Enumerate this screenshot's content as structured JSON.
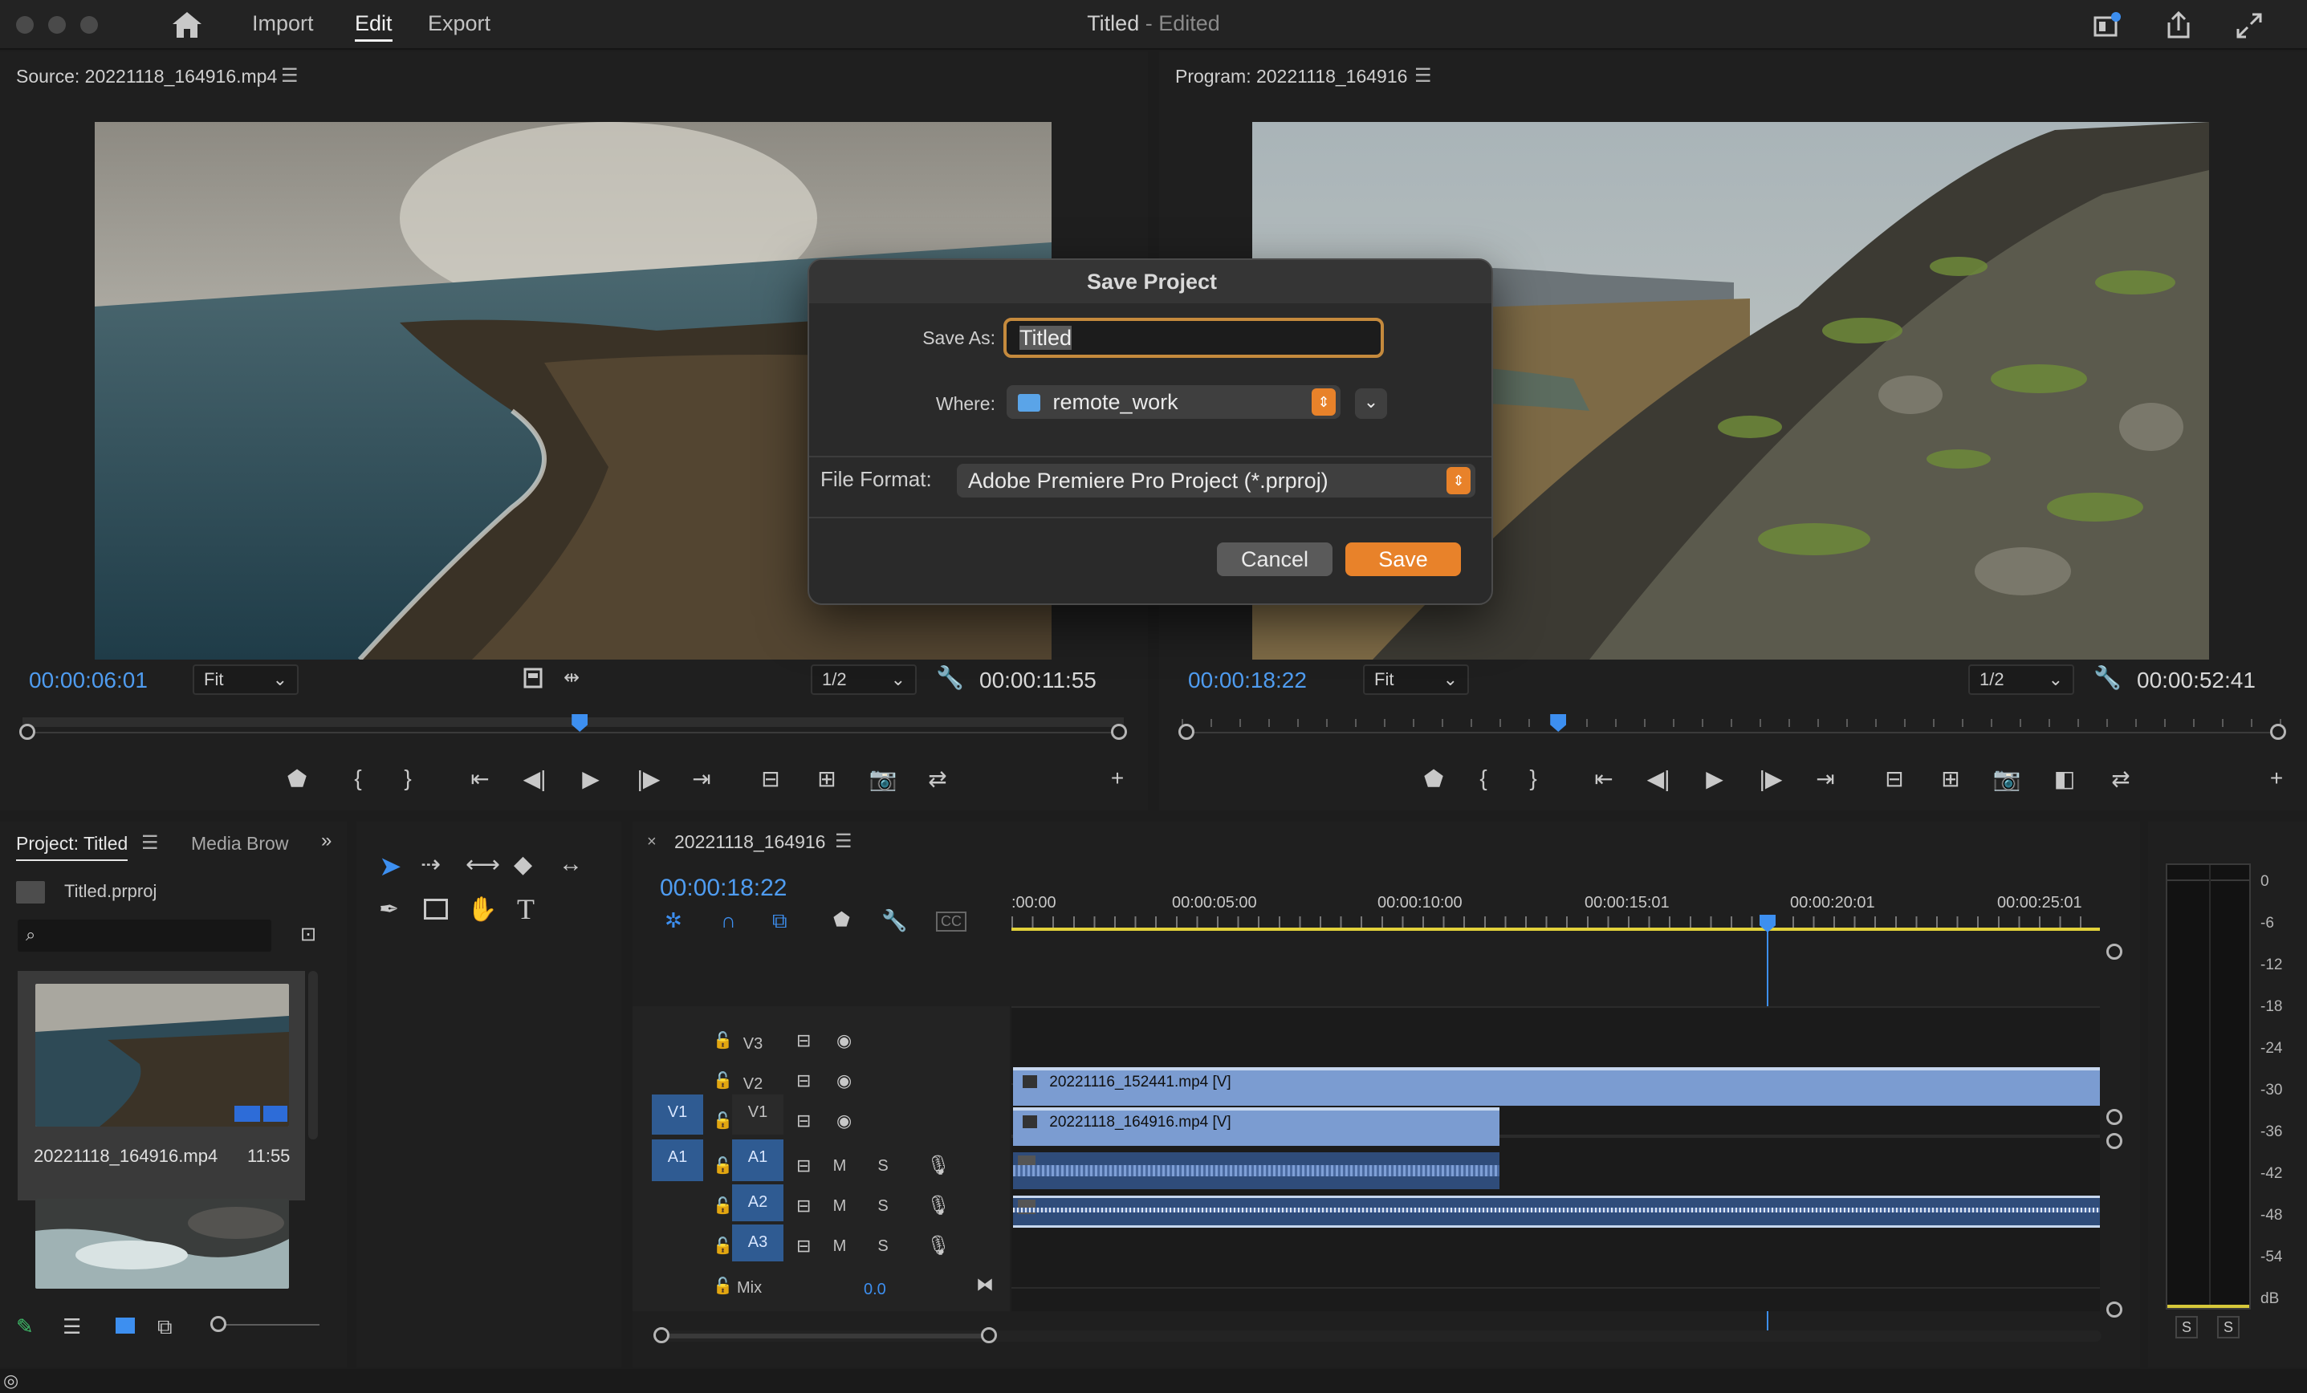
{
  "titlebar": {
    "nav": [
      "Import",
      "Edit",
      "Export"
    ],
    "active_nav": "Edit",
    "title": "Titled",
    "title_suffix": "- Edited"
  },
  "source_monitor": {
    "title": "Source: 20221118_164916.mp4",
    "timecode": "00:00:06:01",
    "fit": "Fit",
    "resolution": "1/2",
    "duration": "00:00:11:55",
    "playhead_fraction": 0.506
  },
  "program_monitor": {
    "title": "Program: 20221118_164916",
    "timecode": "00:00:18:22",
    "fit": "Fit",
    "resolution": "1/2",
    "duration": "00:00:52:41",
    "playhead_fraction": 0.342
  },
  "dialog": {
    "title": "Save Project",
    "save_as_label": "Save As:",
    "save_as_value": "Titled",
    "where_label": "Where:",
    "where_value": "remote_work",
    "format_label": "File Format:",
    "format_value": "Adobe Premiere Pro Project (*.prproj)",
    "cancel": "Cancel",
    "save": "Save",
    "accent": "#e8822a"
  },
  "project_panel": {
    "tab_project": "Project: Titled",
    "tab_media": "Media Brow",
    "file": "Titled.prproj",
    "items": [
      {
        "name": "20221118_164916.mp4",
        "duration": "11:55"
      }
    ]
  },
  "timeline": {
    "sequence": "20221118_164916",
    "timecode": "00:00:18:22",
    "ruler": [
      ":00:00",
      "00:00:05:00",
      "00:00:10:00",
      "00:00:15:01",
      "00:00:20:01",
      "00:00:25:01"
    ],
    "tracks": {
      "v3": "V3",
      "v2": "V2",
      "v1": "V1",
      "v1_src": "V1",
      "a1": "A1",
      "a1_src": "A1",
      "a2": "A2",
      "a3": "A3",
      "m": "M",
      "s": "S",
      "mix": "Mix",
      "mix_value": "0.0"
    },
    "clips": {
      "v2": "20221116_152441.mp4 [V]",
      "v1": "20221118_164916.mp4 [V]"
    }
  },
  "audio_meter": {
    "scale": [
      "0",
      "-6",
      "-12",
      "-18",
      "-24",
      "-30",
      "-36",
      "-42",
      "-48",
      "-54",
      "dB"
    ],
    "solo": [
      "S",
      "S"
    ]
  }
}
